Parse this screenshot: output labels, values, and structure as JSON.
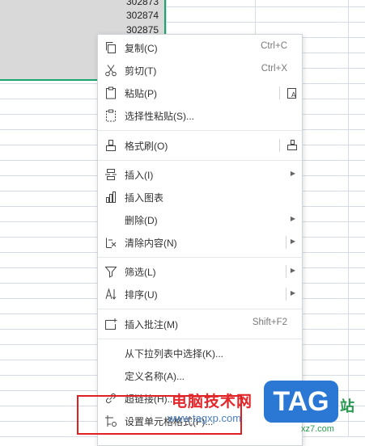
{
  "sheet": {
    "cells": [
      "302873",
      "302874",
      "302875"
    ]
  },
  "menu": {
    "items": [
      {
        "label": "复制(C)",
        "shortcut": "Ctrl+C",
        "icon": "copy-icon"
      },
      {
        "label": "剪切(T)",
        "shortcut": "Ctrl+X",
        "icon": "scissors-icon"
      },
      {
        "label": "粘贴(P)",
        "icon": "paste-icon",
        "right_icon": "paste-format-icon"
      },
      {
        "label": "选择性粘贴(S)...",
        "icon": "paste-special-icon"
      },
      {
        "label": "格式刷(O)",
        "icon": "format-brush-icon",
        "right_icon": "format-brush-small-icon"
      },
      {
        "label": "插入(I)",
        "icon": "insert-icon",
        "submenu": true
      },
      {
        "label": "插入图表",
        "icon": "chart-icon"
      },
      {
        "label": "删除(D)",
        "submenu": true
      },
      {
        "label": "清除内容(N)",
        "icon": "eraser-icon",
        "submenu": true
      },
      {
        "label": "筛选(L)",
        "icon": "filter-icon",
        "submenu": true
      },
      {
        "label": "排序(U)",
        "icon": "sort-icon",
        "submenu": true
      },
      {
        "label": "插入批注(M)",
        "shortcut": "Shift+F2",
        "icon": "comment-icon"
      },
      {
        "label": "从下拉列表中选择(K)..."
      },
      {
        "label": "定义名称(A)..."
      },
      {
        "label": "超链接(H)...",
        "icon": "link-icon"
      },
      {
        "label": "设置单元格格式(F)...",
        "icon": "cell-format-icon"
      }
    ]
  },
  "watermark": {
    "site_cn": "电脑技术网",
    "url": "www.tagxp.com",
    "badge": "TAG",
    "zhan": "站",
    "zhan_small": "xz7.com"
  },
  "colors": {
    "selection_border": "#1aa46e",
    "highlight": "#e02020",
    "watermark_red": "#e3272b",
    "badge_blue": "#2a78d4"
  }
}
